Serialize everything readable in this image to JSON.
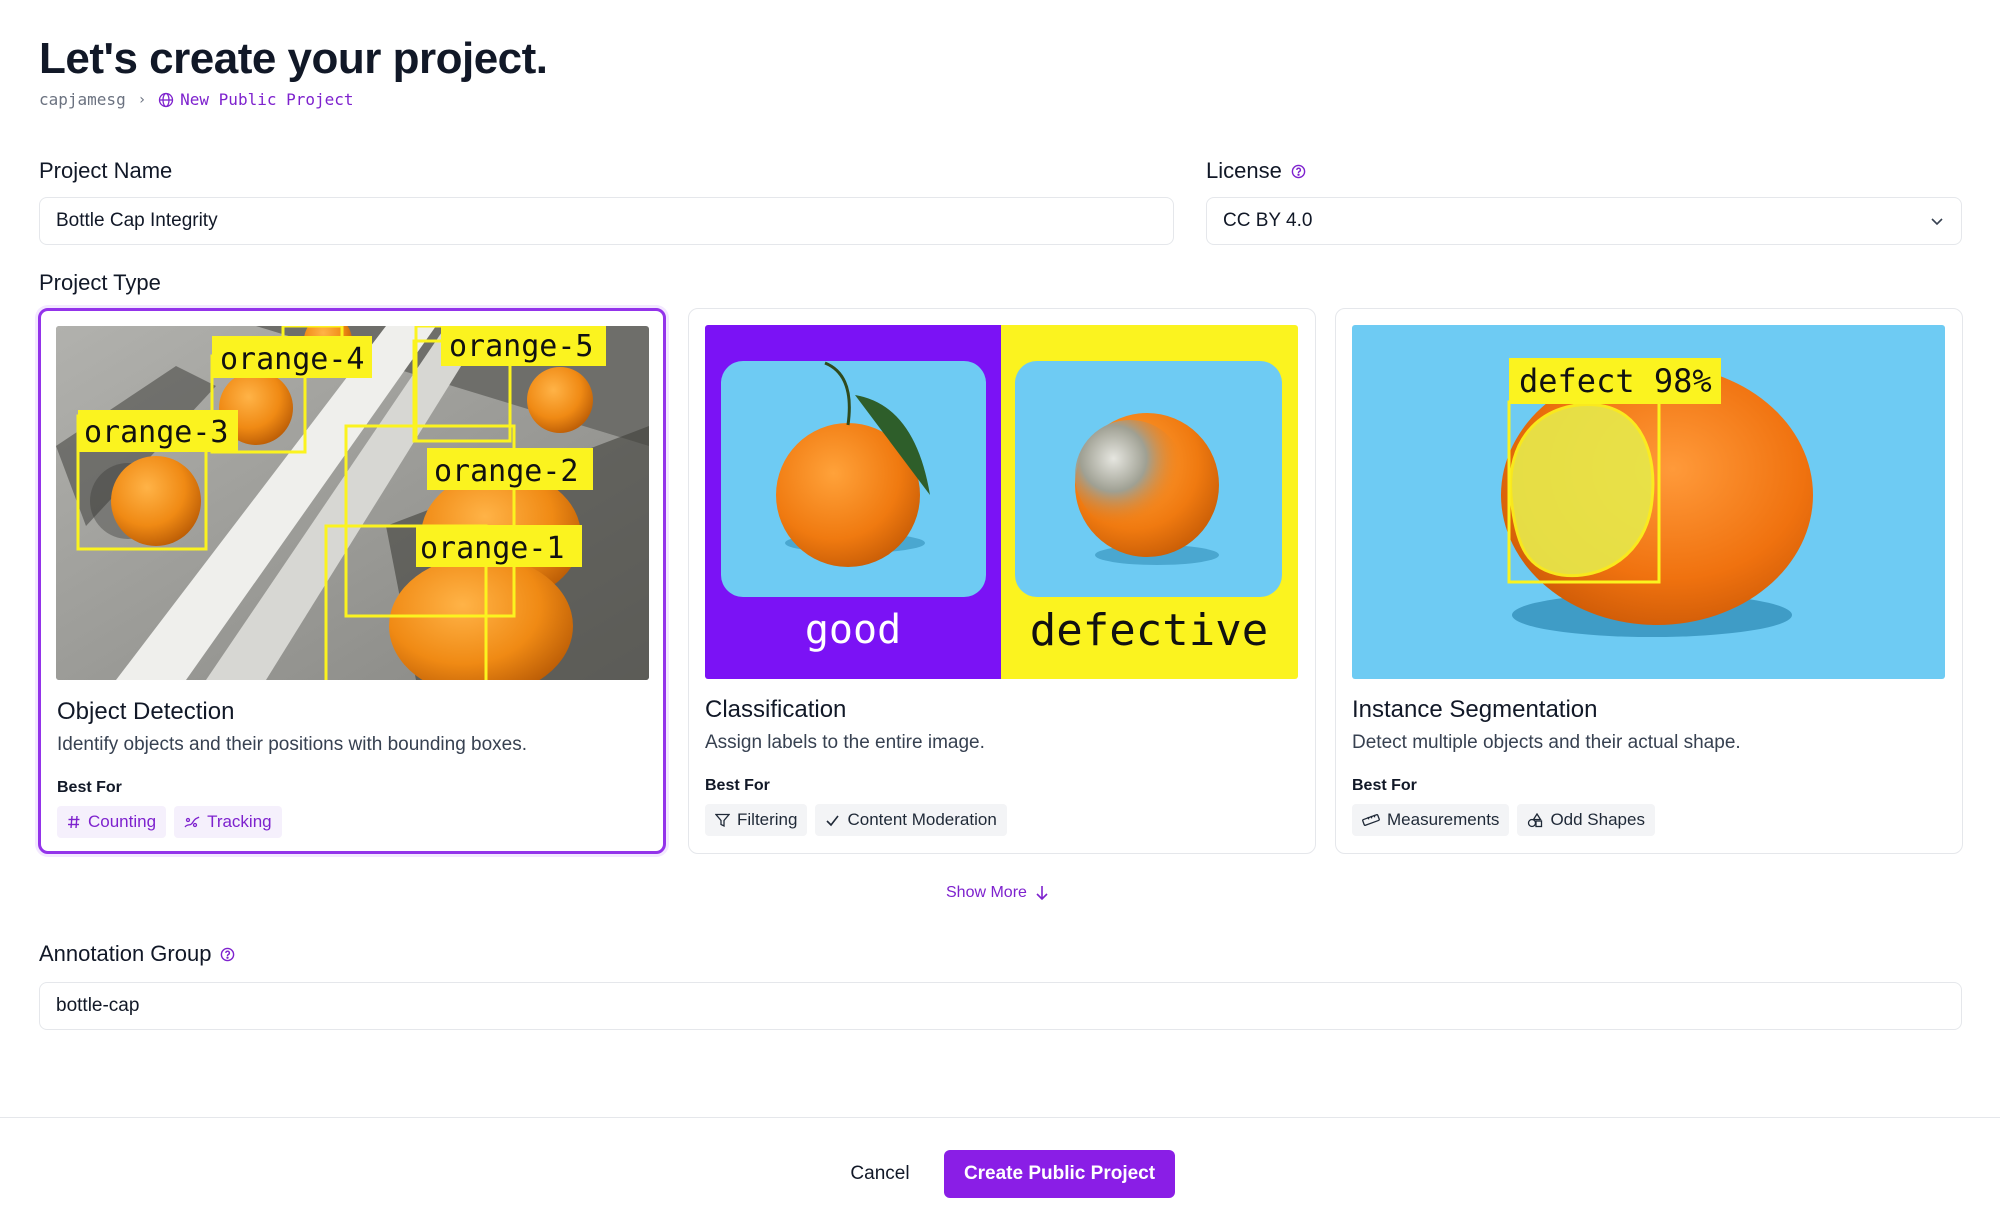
{
  "header": {
    "title": "Let's create your project.",
    "breadcrumb_user": "capjamesg",
    "breadcrumb_project": "New Public Project"
  },
  "form": {
    "project_name_label": "Project Name",
    "project_name_value": "Bottle Cap Integrity",
    "license_label": "License",
    "license_value": "CC BY 4.0",
    "project_type_label": "Project Type",
    "annotation_group_label": "Annotation Group",
    "annotation_group_value": "bottle-cap"
  },
  "project_types": [
    {
      "title": "Object Detection",
      "description": "Identify objects and their positions with bounding boxes.",
      "best_for_label": "Best For",
      "selected": true,
      "tags": [
        {
          "label": "Counting",
          "icon": "hash-icon"
        },
        {
          "label": "Tracking",
          "icon": "tracking-icon"
        }
      ],
      "image_labels": [
        "orange-4",
        "orange-5",
        "orange-3",
        "orange-2",
        "orange-1"
      ]
    },
    {
      "title": "Classification",
      "description": "Assign labels to the entire image.",
      "best_for_label": "Best For",
      "selected": false,
      "tags": [
        {
          "label": "Filtering",
          "icon": "filter-icon"
        },
        {
          "label": "Content Moderation",
          "icon": "check-icon"
        }
      ],
      "image_labels": [
        "good",
        "defective"
      ]
    },
    {
      "title": "Instance Segmentation",
      "description": "Detect multiple objects and their actual shape.",
      "best_for_label": "Best For",
      "selected": false,
      "tags": [
        {
          "label": "Measurements",
          "icon": "ruler-icon"
        },
        {
          "label": "Odd Shapes",
          "icon": "shapes-icon"
        }
      ],
      "image_labels": [
        "defect 98%"
      ]
    }
  ],
  "show_more_label": "Show More",
  "footer": {
    "cancel_label": "Cancel",
    "create_label": "Create Public Project"
  },
  "colors": {
    "accent": "#8a1ee6",
    "label_yellow": "#fbf31f",
    "purple_panel": "#7b12f5",
    "sky_blue": "#6ecbf3"
  }
}
